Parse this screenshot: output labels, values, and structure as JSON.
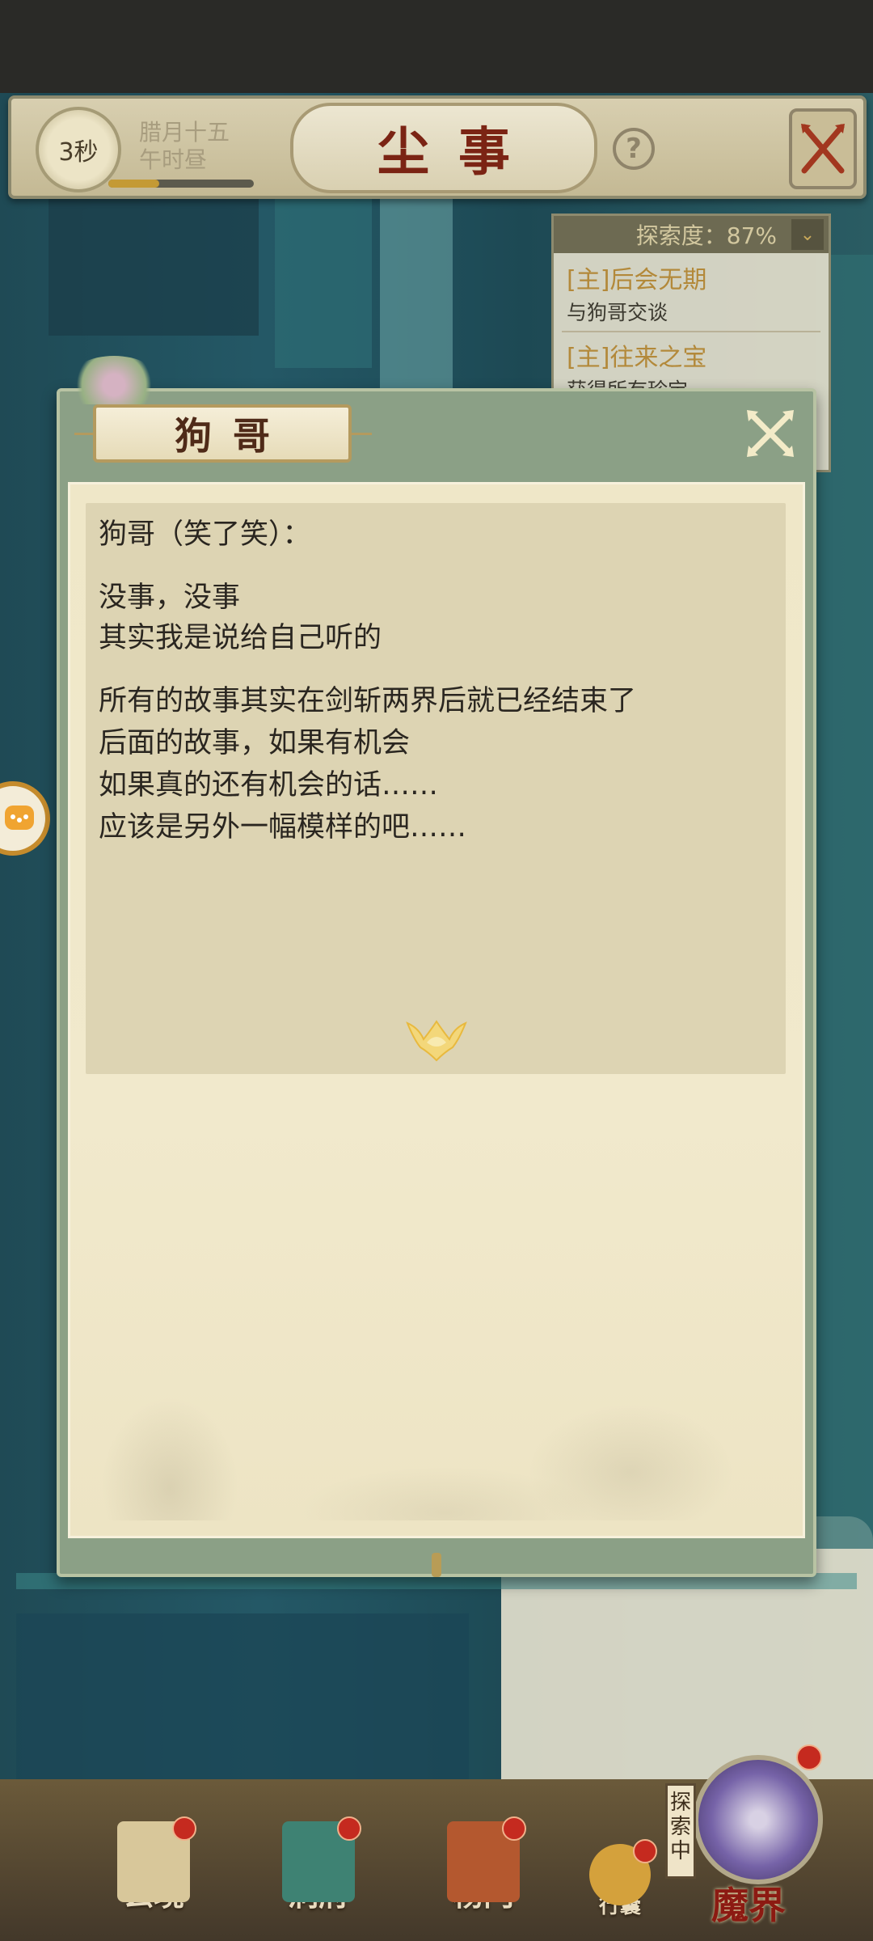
{
  "header": {
    "timer": "3秒",
    "date_line1": "腊月十五",
    "date_line2": "午时昼",
    "time_progress": 0.35,
    "title": "尘事",
    "help": "?"
  },
  "quests": {
    "header_label": "探索度：87%",
    "items": [
      {
        "title": "[主]后会无期",
        "desc": "与狗哥交谈"
      },
      {
        "title": "[主]往来之宝",
        "desc": "获得所有珍宝"
      }
    ]
  },
  "dialog": {
    "speaker": "狗哥",
    "lines": [
      "狗哥（笑了笑）：",
      "没事，没事",
      "其实我是说给自己听的",
      "所有的故事其实在剑斩两界后就已经结束了",
      "后面的故事，如果有机会",
      "如果真的还有机会的话……",
      "应该是另外一幅模样的吧……"
    ]
  },
  "bottom_nav": {
    "items": [
      {
        "label": "玄境"
      },
      {
        "label": "洞府"
      },
      {
        "label": "杨门"
      },
      {
        "label": "行囊"
      }
    ],
    "exploring_tag": "探索中",
    "demon_world": "魔界"
  },
  "colors": {
    "accent_red": "#7b2414",
    "quest_gold": "#b3893a",
    "dialog_frame": "#8ba086",
    "paper": "#efe7c8"
  }
}
